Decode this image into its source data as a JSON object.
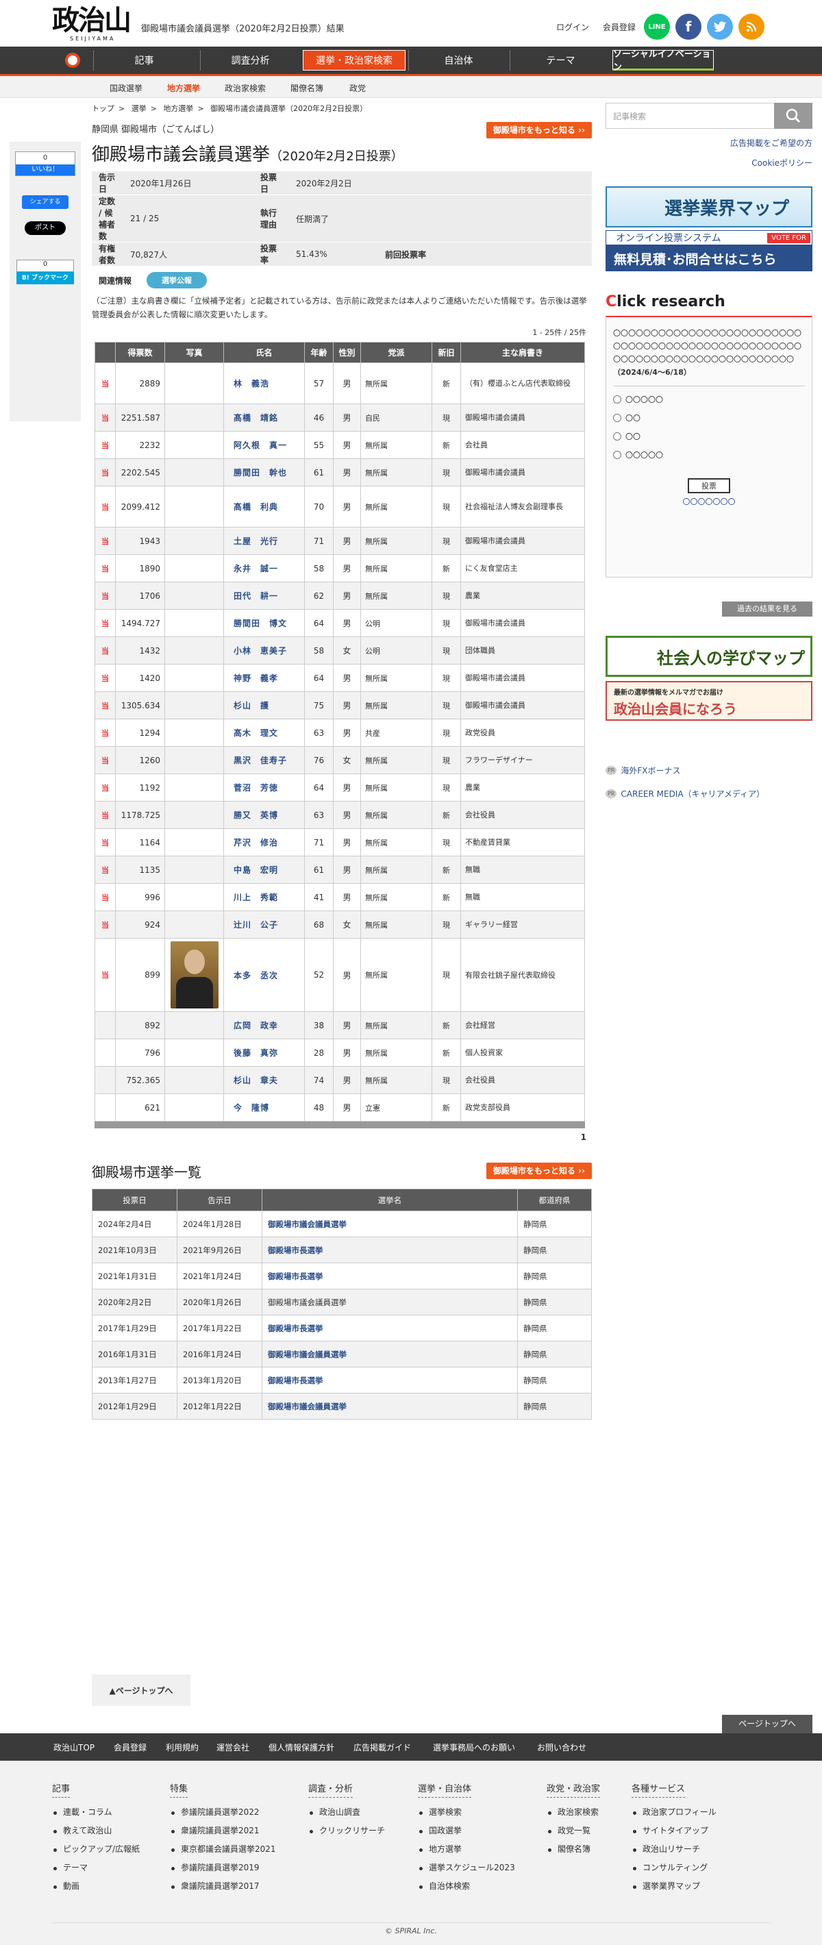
{
  "header": {
    "logo": "政治山",
    "logo_roman": "SEIJIYAMA",
    "page_title": "御殿場市議会議員選挙（2020年2月2日投票）結果",
    "login": "ログイン",
    "register": "会員登録",
    "social": [
      {
        "name": "LINE",
        "color": "#06c755"
      },
      {
        "name": "f",
        "color": "#3b5998"
      },
      {
        "name": "t",
        "color": "#55acee"
      },
      {
        "name": "rss",
        "color": "#f39800"
      }
    ]
  },
  "gnav": [
    "記事",
    "調査分析",
    "選挙・政治家検索",
    "自治体",
    "テーマ",
    "ソーシャルイノベーション"
  ],
  "subnav": [
    "国政選挙",
    "地方選挙",
    "政治家検索",
    "閣僚名簿",
    "政党"
  ],
  "breadcrumb": [
    "トップ",
    "選挙",
    "地方選挙",
    "御殿場市議会議員選挙（2020年2月2日投票）"
  ],
  "pref": "静岡県 御殿場市（ごてんばし）",
  "more_btn": "御殿場市をもっと知る ››",
  "title": "御殿場市議会議員選挙",
  "title_date": "（2020年2月2日投票）",
  "info": {
    "kokuji_k": "告示日",
    "kokuji": "2020年1月26日",
    "tohyo_k": "投票日",
    "tohyo": "2020年2月2日",
    "teisu_k": "定数 / 候補者数",
    "teisu": "21 / 25",
    "riyu_k": "執行理由",
    "riyu": "任期満了",
    "yuken_k": "有権者数",
    "yuken": "70,827人",
    "ritsu_k": "投票率",
    "ritsu": "51.43%",
    "zenkai_k": "前回投票率",
    "zenkai": ""
  },
  "related": {
    "label": "関連情報",
    "pill": "選挙公報"
  },
  "note": "（ご注意）主な肩書き欄に「立候補予定者」と記載されている方は、告示前に政党または本人よりご連絡いただいた情報です。告示後は選挙管理委員会が公表した情報に順次変更いたします。",
  "count": "1 - 25件 / 25件",
  "table_headers": [
    "",
    "得票数",
    "写真",
    "氏名",
    "年齢",
    "性別",
    "党派",
    "新旧",
    "主な肩書き"
  ],
  "win_mark": "当",
  "results": [
    {
      "win": true,
      "votes": "2889",
      "name": "林　義浩",
      "age": "57",
      "sex": "男",
      "party": "無所属",
      "status": "新",
      "title": "（有）櫻道ふとん店代表取締役"
    },
    {
      "win": true,
      "votes": "2251.587",
      "name": "髙橋　靖銘",
      "age": "46",
      "sex": "男",
      "party": "自民",
      "status": "現",
      "title": "御殿場市議会議員"
    },
    {
      "win": true,
      "votes": "2232",
      "name": "阿久根　真一",
      "age": "55",
      "sex": "男",
      "party": "無所属",
      "status": "新",
      "title": "会社員"
    },
    {
      "win": true,
      "votes": "2202.545",
      "name": "勝間田　幹也",
      "age": "61",
      "sex": "男",
      "party": "無所属",
      "status": "現",
      "title": "御殿場市議会議員"
    },
    {
      "win": true,
      "votes": "2099.412",
      "name": "髙橋　利典",
      "age": "70",
      "sex": "男",
      "party": "無所属",
      "status": "現",
      "title": "社会福祉法人博友会副理事長"
    },
    {
      "win": true,
      "votes": "1943",
      "name": "土屋　光行",
      "age": "71",
      "sex": "男",
      "party": "無所属",
      "status": "現",
      "title": "御殿場市議会議員"
    },
    {
      "win": true,
      "votes": "1890",
      "name": "永井　誠一",
      "age": "58",
      "sex": "男",
      "party": "無所属",
      "status": "新",
      "title": "にく友食堂店主"
    },
    {
      "win": true,
      "votes": "1706",
      "name": "田代　耕一",
      "age": "62",
      "sex": "男",
      "party": "無所属",
      "status": "現",
      "title": "農業"
    },
    {
      "win": true,
      "votes": "1494.727",
      "name": "勝間田　博文",
      "age": "64",
      "sex": "男",
      "party": "公明",
      "status": "現",
      "title": "御殿場市議会議員"
    },
    {
      "win": true,
      "votes": "1432",
      "name": "小林　恵美子",
      "age": "58",
      "sex": "女",
      "party": "公明",
      "status": "現",
      "title": "団体職員"
    },
    {
      "win": true,
      "votes": "1420",
      "name": "神野　義孝",
      "age": "64",
      "sex": "男",
      "party": "無所属",
      "status": "現",
      "title": "御殿場市議会議員"
    },
    {
      "win": true,
      "votes": "1305.634",
      "name": "杉山　護",
      "age": "75",
      "sex": "男",
      "party": "無所属",
      "status": "現",
      "title": "御殿場市議会議員"
    },
    {
      "win": true,
      "votes": "1294",
      "name": "髙木　理文",
      "age": "63",
      "sex": "男",
      "party": "共産",
      "status": "現",
      "title": "政党役員"
    },
    {
      "win": true,
      "votes": "1260",
      "name": "黒沢　佳寿子",
      "age": "76",
      "sex": "女",
      "party": "無所属",
      "status": "現",
      "title": "フラワーデザイナー"
    },
    {
      "win": true,
      "votes": "1192",
      "name": "菅沼　芳徳",
      "age": "64",
      "sex": "男",
      "party": "無所属",
      "status": "現",
      "title": "農業"
    },
    {
      "win": true,
      "votes": "1178.725",
      "name": "勝又　英博",
      "age": "63",
      "sex": "男",
      "party": "無所属",
      "status": "新",
      "title": "会社役員"
    },
    {
      "win": true,
      "votes": "1164",
      "name": "芹沢　修治",
      "age": "71",
      "sex": "男",
      "party": "無所属",
      "status": "現",
      "title": "不動産賃貸業"
    },
    {
      "win": true,
      "votes": "1135",
      "name": "中島　宏明",
      "age": "61",
      "sex": "男",
      "party": "無所属",
      "status": "新",
      "title": "無職"
    },
    {
      "win": true,
      "votes": "996",
      "name": "川上　秀範",
      "age": "41",
      "sex": "男",
      "party": "無所属",
      "status": "新",
      "title": "無職"
    },
    {
      "win": true,
      "votes": "924",
      "name": "辻川　公子",
      "age": "68",
      "sex": "女",
      "party": "無所属",
      "status": "現",
      "title": "ギャラリー経営"
    },
    {
      "win": true,
      "votes": "899",
      "name": "本多　丞次",
      "age": "52",
      "sex": "男",
      "party": "無所属",
      "status": "現",
      "title": "有限会社銚子屋代表取締役",
      "photo": true
    },
    {
      "win": false,
      "votes": "892",
      "name": "広岡　政幸",
      "age": "38",
      "sex": "男",
      "party": "無所属",
      "status": "新",
      "title": "会社経営"
    },
    {
      "win": false,
      "votes": "796",
      "name": "後藤　真弥",
      "age": "28",
      "sex": "男",
      "party": "無所属",
      "status": "新",
      "title": "個人投資家"
    },
    {
      "win": false,
      "votes": "752.365",
      "name": "杉山　章夫",
      "age": "74",
      "sex": "男",
      "party": "無所属",
      "status": "現",
      "title": "会社役員"
    },
    {
      "win": false,
      "votes": "621",
      "name": "今　隆博",
      "age": "48",
      "sex": "男",
      "party": "立憲",
      "status": "新",
      "title": "政党支部役員"
    }
  ],
  "pager": "1",
  "election_list": {
    "title": "御殿場市選挙一覧",
    "headers": [
      "投票日",
      "告示日",
      "選挙名",
      "都道府県"
    ],
    "rows": [
      {
        "vote": "2024年2月4日",
        "notice": "2024年1月28日",
        "name": "御殿場市議会議員選挙",
        "pref": "静岡県",
        "link": true
      },
      {
        "vote": "2021年10月3日",
        "notice": "2021年9月26日",
        "name": "御殿場市長選挙",
        "pref": "静岡県",
        "link": true
      },
      {
        "vote": "2021年1月31日",
        "notice": "2021年1月24日",
        "name": "御殿場市長選挙",
        "pref": "静岡県",
        "link": true
      },
      {
        "vote": "2020年2月2日",
        "notice": "2020年1月26日",
        "name": "御殿場市議会議員選挙",
        "pref": "静岡県",
        "link": false
      },
      {
        "vote": "2017年1月29日",
        "notice": "2017年1月22日",
        "name": "御殿場市長選挙",
        "pref": "静岡県",
        "link": true
      },
      {
        "vote": "2016年1月31日",
        "notice": "2016年1月24日",
        "name": "御殿場市議会議員選挙",
        "pref": "静岡県",
        "link": true
      },
      {
        "vote": "2013年1月27日",
        "notice": "2013年1月20日",
        "name": "御殿場市長選挙",
        "pref": "静岡県",
        "link": true
      },
      {
        "vote": "2012年1月29日",
        "notice": "2012年1月22日",
        "name": "御殿場市議会議員選挙",
        "pref": "静岡県",
        "link": true
      }
    ]
  },
  "pagetop": "▲ページトップへ",
  "pagetop2": "ページトップへ",
  "share": {
    "fb_count": "0",
    "fb_like": "いいね！",
    "fb_share": "シェアする",
    "tweet": "ポスト",
    "hatena_count": "0",
    "hatena": "B! ブックマーク"
  },
  "sidebar": {
    "search_placeholder": "記事検索",
    "ad_link": "広告掲載をご希望の方",
    "cookie": "Cookieポリシー",
    "banner1": "選挙業界マップ",
    "banner2a": "オンライン投票システム",
    "banner2b": "無料見積･お問合せはこちら",
    "banner2c": "VOTE FOR",
    "click_research_c": "C",
    "click_research": "lick research",
    "poll_text": "〇〇〇〇〇〇〇〇〇〇〇〇〇〇〇〇〇〇〇〇〇〇〇〇〇〇〇〇〇〇〇〇〇〇〇〇〇〇〇〇〇〇〇〇〇〇〇〇〇〇〇〇〇〇〇〇〇〇〇〇〇〇〇〇〇〇〇〇〇〇〇〇〇〇",
    "poll_period": "（2024/6/4～6/18）",
    "poll_options": [
      "〇〇〇〇〇",
      "〇〇",
      "〇〇",
      "〇〇〇〇〇"
    ],
    "vote_btn": "投票",
    "poll_link": "〇〇〇〇〇〇〇",
    "past": "過去の結果を見る",
    "banner3": "社会人の学びマップ",
    "banner4a": "最新の選挙情報をメルマガでお届け",
    "banner4b": "政治山会員になろう",
    "pr_tag": "PR",
    "pr1": "海外FXボーナス",
    "pr2": "CAREER MEDIA（キャリアメディア）"
  },
  "footer": {
    "links": [
      "政治山TOP",
      "会員登録",
      "利用規約",
      "運営会社",
      "個人情報保護方針",
      "広告掲載ガイド",
      "選挙事務局へのお願い",
      "お問い合わせ"
    ],
    "cols": [
      {
        "h": "記事",
        "items": [
          "連載・コラム",
          "教えて政治山",
          "ピックアップ/広報紙",
          "テーマ",
          "動画"
        ]
      },
      {
        "h": "特集",
        "items": [
          "参議院議員選挙2022",
          "衆議院議員選挙2021",
          "東京都議会議員選挙2021",
          "参議院議員選挙2019",
          "衆議院議員選挙2017"
        ]
      },
      {
        "h": "調査・分析",
        "items": [
          "政治山調査",
          "クリックリサーチ"
        ]
      },
      {
        "h": "選挙・自治体",
        "items": [
          "選挙検索",
          "国政選挙",
          "地方選挙",
          "選挙スケジュール2023",
          "自治体検索"
        ]
      },
      {
        "h": "政党・政治家",
        "items": [
          "政治家検索",
          "政党一覧",
          "閣僚名簿"
        ]
      },
      {
        "h": "各種サービス",
        "items": [
          "政治家プロフィール",
          "サイトタイアップ",
          "政治山リサーチ",
          "コンサルティング",
          "選挙業界マップ"
        ]
      }
    ],
    "copyright": "© SPIRAL Inc."
  }
}
